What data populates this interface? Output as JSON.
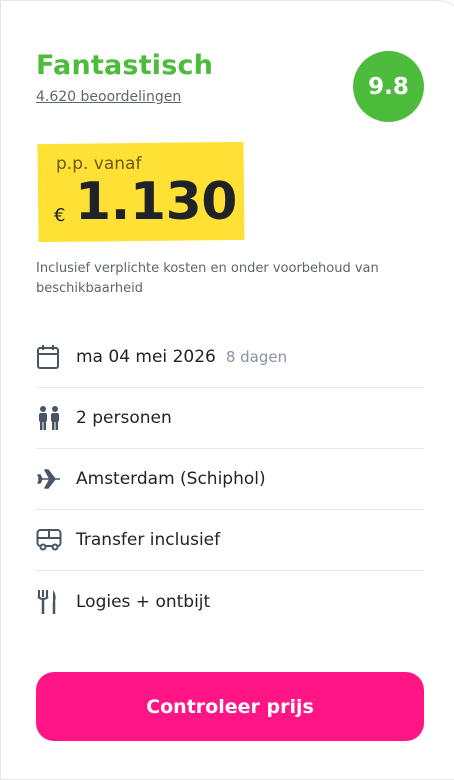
{
  "rating": {
    "label": "Fantastisch",
    "reviews": "4.620 beoordelingen",
    "score": "9.8",
    "color": "#4dbb3c"
  },
  "price": {
    "prefix": "p.p. vanaf",
    "currency": "€",
    "amount": "1.130",
    "highlight_color": "#ffe135"
  },
  "disclaimer": "Inclusief verplichte kosten en onder voorbehoud van beschikbaarheid",
  "details": {
    "date": "ma 04 mei 2026",
    "duration": "8 dagen",
    "persons": "2 personen",
    "departure": "Amsterdam (Schiphol)",
    "transfer": "Transfer inclusief",
    "board": "Logies + ontbijt"
  },
  "icons": {
    "date": "calendar-icon",
    "persons": "people-icon",
    "departure": "plane-icon",
    "transfer": "bus-icon",
    "board": "cutlery-icon"
  },
  "cta": {
    "label": "Controleer prijs",
    "color": "#ff1586"
  }
}
